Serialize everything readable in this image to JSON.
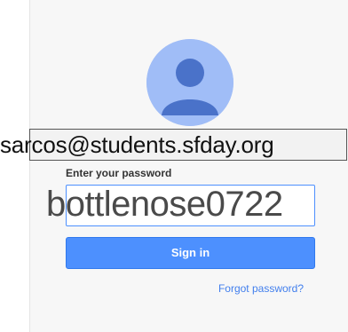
{
  "account": {
    "email": "sarcos@students.sfday.org",
    "avatar_icon": "default-user-avatar-icon",
    "avatar_color": "#a0bdf7"
  },
  "password": {
    "label": "Enter your password",
    "value": "bottlenose0722"
  },
  "actions": {
    "sign_in_label": "Sign in",
    "forgot_password_label": "Forgot password?"
  },
  "colors": {
    "primary_button": "#4d90fe",
    "link": "#427fed",
    "focus_border": "#4d90fe",
    "card_background": "#f7f7f7"
  }
}
